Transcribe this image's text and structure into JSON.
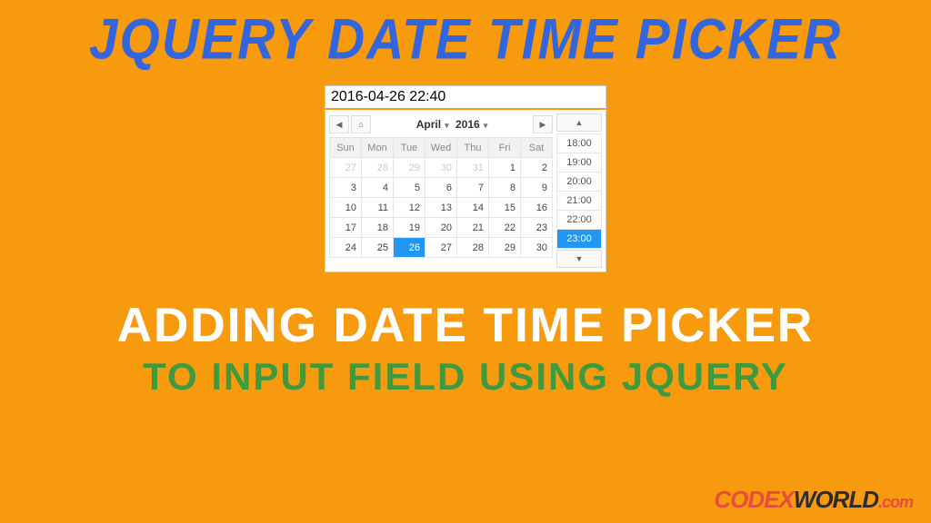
{
  "headline_top": "JQuery Date Time Picker",
  "subhead_1": "Adding Date Time Picker",
  "subhead_2": "to Input Field using jQuery",
  "brand": {
    "p1": "CODEX",
    "p2": "WORLD",
    "p3": ".com"
  },
  "picker": {
    "input_value": "2016-04-26 22:40",
    "month_label": "April",
    "year_label": "2016",
    "dow": [
      "Sun",
      "Mon",
      "Tue",
      "Wed",
      "Thu",
      "Fri",
      "Sat"
    ],
    "weeks": [
      [
        {
          "d": "27",
          "other": true
        },
        {
          "d": "28",
          "other": true
        },
        {
          "d": "29",
          "other": true
        },
        {
          "d": "30",
          "other": true
        },
        {
          "d": "31",
          "other": true
        },
        {
          "d": "1"
        },
        {
          "d": "2"
        }
      ],
      [
        {
          "d": "3"
        },
        {
          "d": "4"
        },
        {
          "d": "5"
        },
        {
          "d": "6"
        },
        {
          "d": "7"
        },
        {
          "d": "8"
        },
        {
          "d": "9"
        }
      ],
      [
        {
          "d": "10"
        },
        {
          "d": "11"
        },
        {
          "d": "12"
        },
        {
          "d": "13"
        },
        {
          "d": "14"
        },
        {
          "d": "15"
        },
        {
          "d": "16"
        }
      ],
      [
        {
          "d": "17"
        },
        {
          "d": "18"
        },
        {
          "d": "19"
        },
        {
          "d": "20"
        },
        {
          "d": "21"
        },
        {
          "d": "22"
        },
        {
          "d": "23"
        }
      ],
      [
        {
          "d": "24"
        },
        {
          "d": "25"
        },
        {
          "d": "26",
          "sel": true
        },
        {
          "d": "27"
        },
        {
          "d": "28"
        },
        {
          "d": "29"
        },
        {
          "d": "30"
        }
      ]
    ],
    "times": [
      {
        "t": "18:00"
      },
      {
        "t": "19:00"
      },
      {
        "t": "20:00"
      },
      {
        "t": "21:00"
      },
      {
        "t": "22:00"
      },
      {
        "t": "23:00",
        "sel": true
      }
    ]
  }
}
